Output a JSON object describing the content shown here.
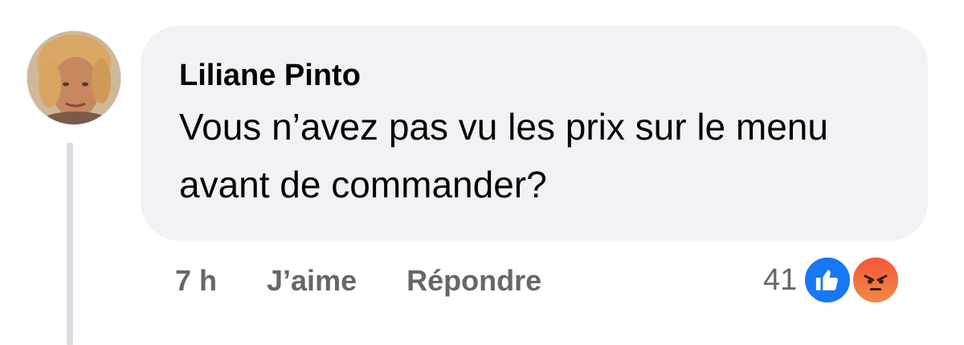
{
  "comment": {
    "author": "Liliane Pinto",
    "text": "Vous n’avez pas vu les prix sur le menu avant de commander?",
    "timestamp": "7 h",
    "actions": {
      "like_label": "J’aime",
      "reply_label": "Répondre"
    },
    "reactions": {
      "count": "41",
      "types": [
        "like-icon",
        "angry-icon"
      ],
      "colors": {
        "like": "#1877f2",
        "angry": "#f5563a"
      }
    }
  }
}
